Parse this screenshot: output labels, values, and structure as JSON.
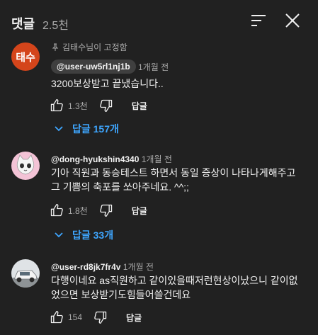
{
  "header": {
    "title": "댓글",
    "count": "2.5천"
  },
  "icons": {
    "sort": "sort-icon",
    "close": "close-icon",
    "like": "thumb-up-icon",
    "dislike": "thumb-down-icon",
    "chevron": "chevron-down-icon",
    "pin": "pin-icon"
  },
  "colors": {
    "background": "#212121",
    "accent": "#3ea6ff",
    "secondary_text": "#aaaaaa"
  },
  "comments": [
    {
      "avatar_text": "태수",
      "pinned_label": "김태수님이 고정함",
      "author": "@user-uw5rl1nj1b",
      "time": "1개월 전",
      "text": "3200보상받고 끝냈습니다..",
      "likes": "1.3천",
      "reply_label": "답글",
      "replies_label": "답글 157개"
    },
    {
      "author": "@dong-hyukshin4340",
      "time": "1개월 전",
      "text": "기아 직원과 동승테스트 하면서 동일 증상이 나타나게해주고 그 기쁨의 축포를 쏘아주네요. ^^;;",
      "likes": "1.8천",
      "reply_label": "답글",
      "replies_label": "답글 33개"
    },
    {
      "author": "@user-rd8jk7fr4v",
      "time": "1개월 전",
      "text": "다행이네요 as직원하고 같이있을때저런현상이났으니 같이없었으면 보상받기도힘들어쓸건데요",
      "likes": "154",
      "reply_label": "답글"
    }
  ]
}
